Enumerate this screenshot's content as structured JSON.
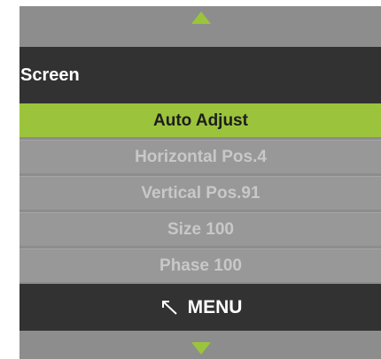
{
  "navigation": {
    "up_icon": "triangle-up-icon",
    "down_icon": "triangle-down-icon",
    "arrow_color": "#9bc43c"
  },
  "title": "Screen",
  "items": [
    {
      "label": "Auto Adjust",
      "selected": true
    },
    {
      "label": "Horizontal Pos.4",
      "selected": false
    },
    {
      "label": "Vertical Pos.91",
      "selected": false
    },
    {
      "label": "Size 100",
      "selected": false
    },
    {
      "label": "Phase 100",
      "selected": false
    }
  ],
  "footer": {
    "icon": "back-arrow-icon",
    "label": "MENU"
  },
  "colors": {
    "highlight": "#9bc43c",
    "dark_bar": "#323232",
    "panel": "#8d8d8d"
  }
}
